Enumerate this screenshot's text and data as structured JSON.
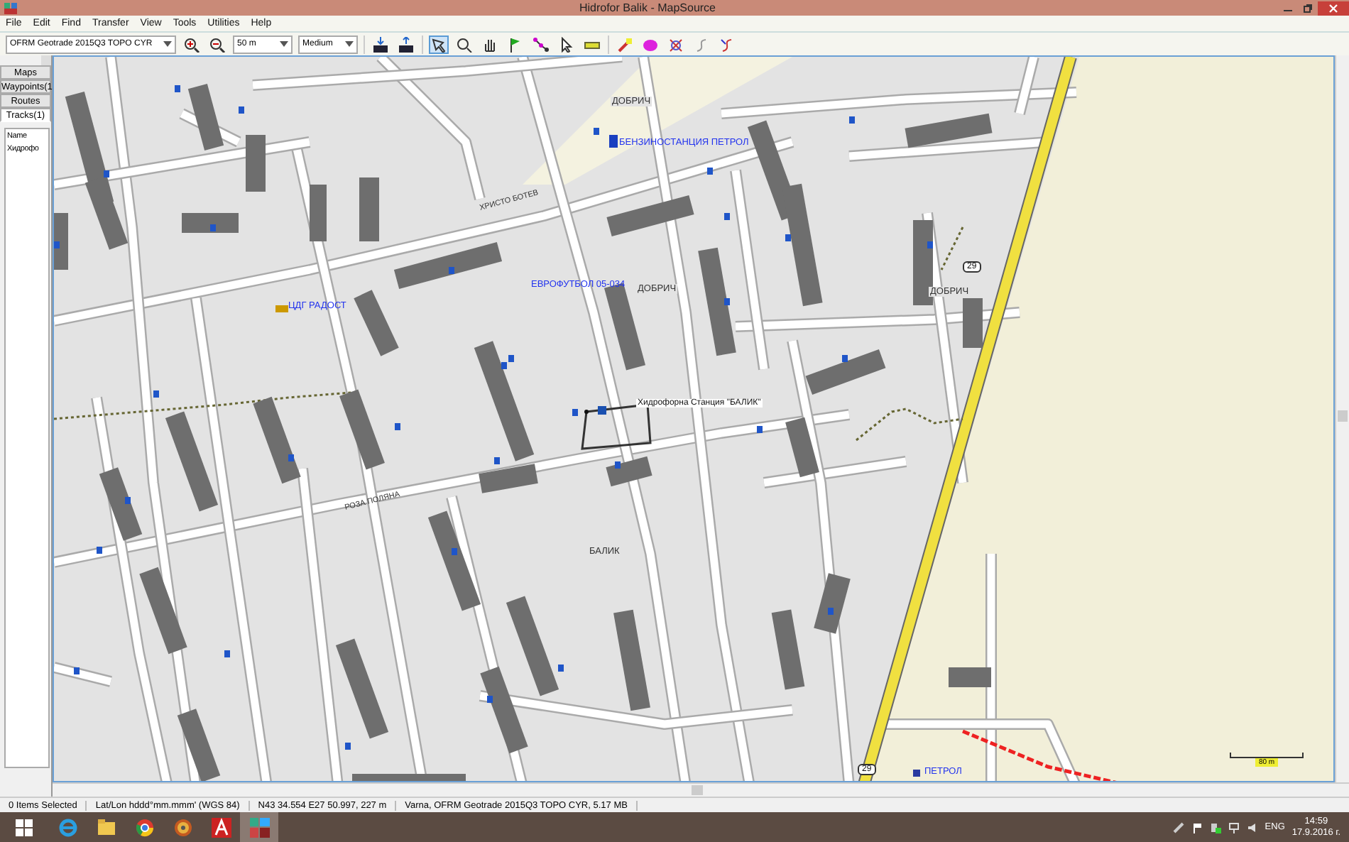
{
  "window": {
    "title": "Hidrofor Balik - MapSource"
  },
  "menu": [
    "File",
    "Edit",
    "Find",
    "Transfer",
    "View",
    "Tools",
    "Utilities",
    "Help"
  ],
  "toolbar": {
    "map_product": "OFRM Geotrade 2015Q3 TOPO CYR",
    "scale": "50 m",
    "detail": "Medium",
    "tools": [
      {
        "kind": "select",
        "selected": true
      },
      {
        "kind": "zoom",
        "selected": false
      },
      {
        "kind": "hand",
        "selected": false
      },
      {
        "kind": "flag",
        "selected": false
      },
      {
        "kind": "route",
        "selected": false
      },
      {
        "kind": "pointer",
        "selected": false
      },
      {
        "kind": "measure",
        "selected": false
      }
    ]
  },
  "sidebar": {
    "tabs": [
      {
        "label": "Maps",
        "selected": false
      },
      {
        "label": "Waypoints(1",
        "selected": false
      },
      {
        "label": "Routes",
        "selected": false
      },
      {
        "label": "Tracks(1)",
        "selected": true
      }
    ],
    "list": {
      "column": "Name",
      "rows": [
        "Хидрофо"
      ]
    }
  },
  "map": {
    "labels": [
      {
        "text": "ДОБРИЧ",
        "kind": "place"
      },
      {
        "text": "БЕНЗИНОСТАНЦИЯ ПЕТРОЛ",
        "kind": "poi"
      },
      {
        "text": "ХРИСТО БОТЕВ",
        "kind": "street"
      },
      {
        "text": "29",
        "kind": "shield"
      },
      {
        "text": "ЕВРОФУТБОЛ 05-034",
        "kind": "poi"
      },
      {
        "text": "ДОБРИЧ",
        "kind": "place"
      },
      {
        "text": "ДОБРИЧ",
        "kind": "place"
      },
      {
        "text": "ЦДГ РАДОСТ",
        "kind": "poi"
      },
      {
        "text": "Хидрофорна Станция \"БАЛИК\"",
        "kind": "waypoint"
      },
      {
        "text": "РОЗА ПОЛЯНА",
        "kind": "street"
      },
      {
        "text": "БАЛИК",
        "kind": "place"
      },
      {
        "text": "29",
        "kind": "shield"
      },
      {
        "text": "ПЕТРОЛ",
        "kind": "poi"
      }
    ],
    "scale_label": "80 m"
  },
  "status_bar": [
    "0 Items Selected",
    "Lat/Lon hddd°mm.mmm' (WGS 84)",
    "N43 34.554 E27 50.997, 227 m",
    "Varna, OFRM Geotrade 2015Q3 TOPO CYR, 5.17 MB"
  ],
  "taskbar": {
    "apps": [
      {
        "kind": "ie",
        "selected": false
      },
      {
        "kind": "folder",
        "selected": false
      },
      {
        "kind": "chrome",
        "selected": false
      },
      {
        "kind": "disc",
        "selected": false
      },
      {
        "kind": "cad",
        "selected": false
      },
      {
        "kind": "mapsource",
        "selected": true
      }
    ],
    "language": "ENG",
    "time": "14:59",
    "date": "17.9.2016 г."
  }
}
